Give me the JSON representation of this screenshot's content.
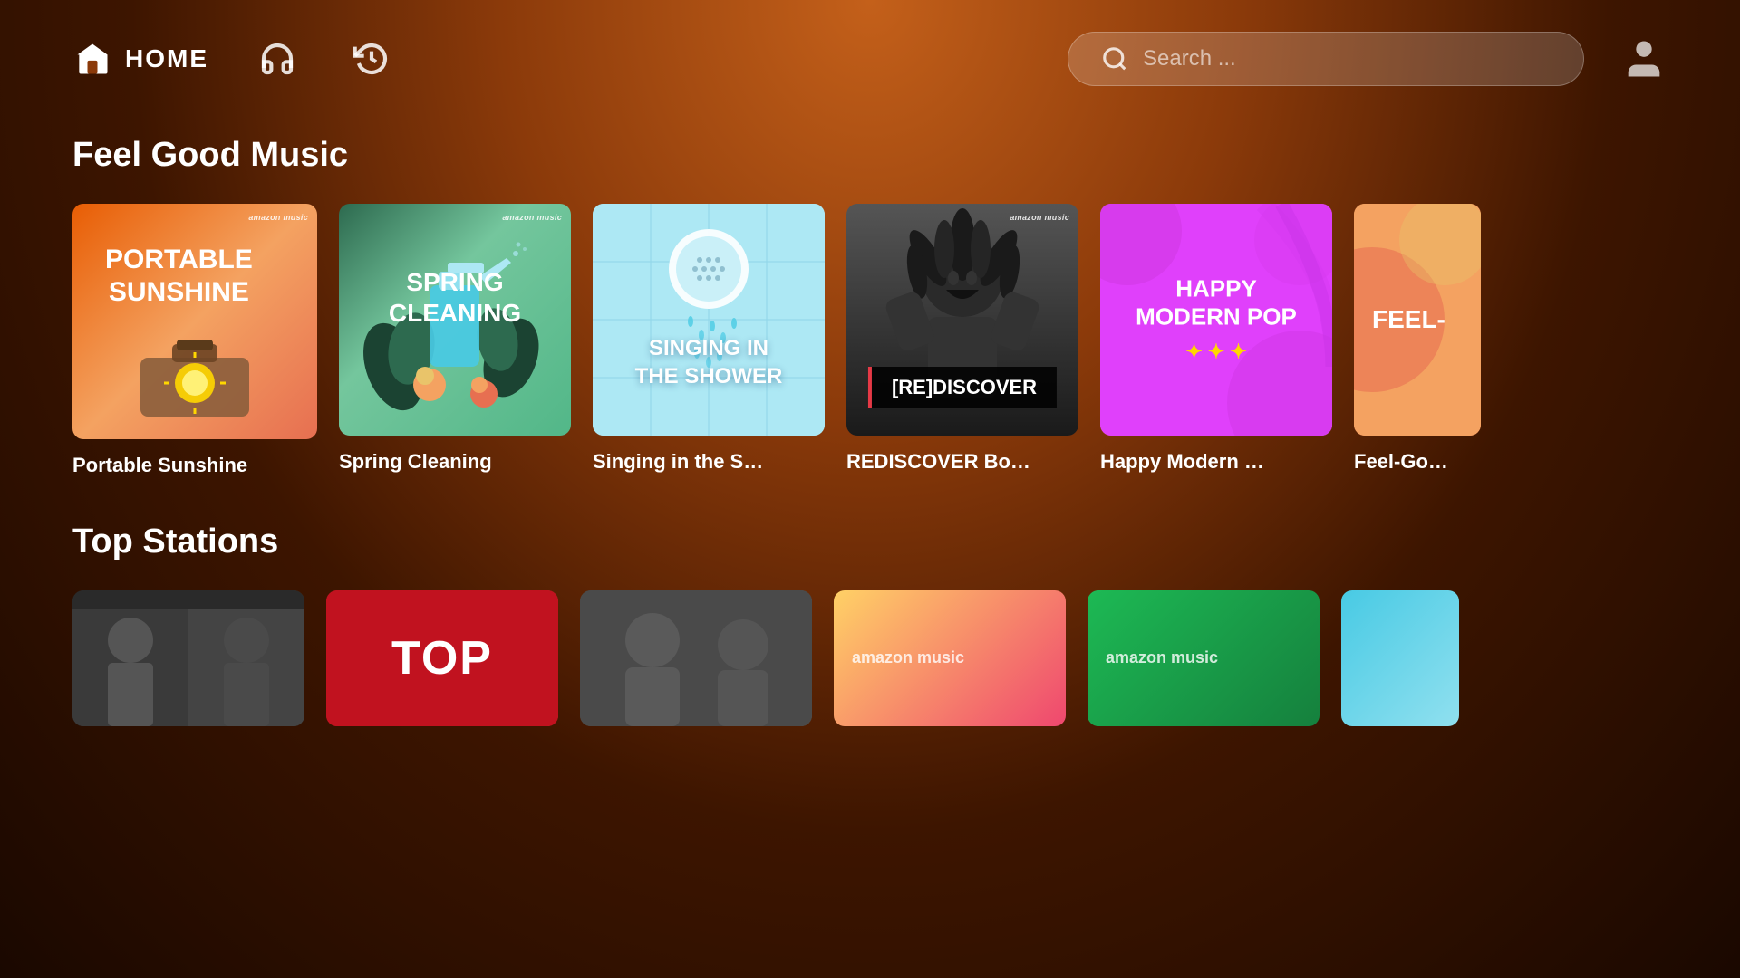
{
  "header": {
    "home_label": "HOME",
    "search_placeholder": "Search ...",
    "nav": {
      "home": "home",
      "headphones": "headphones",
      "history": "history",
      "profile": "profile"
    }
  },
  "sections": {
    "feel_good": {
      "title": "Feel Good Music",
      "cards": [
        {
          "id": "portable-sunshine",
          "label": "Portable Sunshine",
          "title_line1": "PORTABLE",
          "title_line2": "SUNSHINE"
        },
        {
          "id": "spring-cleaning",
          "label": "Spring Cleaning",
          "title_line1": "SPRING",
          "title_line2": "CLEANING"
        },
        {
          "id": "singing-shower",
          "label": "Singing in the S…",
          "title_line1": "SINGING IN",
          "title_line2": "THE SHOWER"
        },
        {
          "id": "rediscover",
          "label": "REDISCOVER Bo…",
          "badge": "[RE]DISCOVER"
        },
        {
          "id": "happy-modern",
          "label": "Happy Modern …",
          "title_line1": "HAPPY",
          "title_line2": "MODERN POP"
        },
        {
          "id": "feel-good-partial",
          "label": "Feel-Go…",
          "partial_text": "FEEL-"
        }
      ]
    },
    "top_stations": {
      "title": "Top Stations",
      "cards": [
        {
          "id": "station-1",
          "type": "dark"
        },
        {
          "id": "station-2",
          "type": "red",
          "text": "ToP"
        },
        {
          "id": "station-3",
          "type": "muted"
        },
        {
          "id": "station-4",
          "type": "yellow-pink"
        },
        {
          "id": "station-5",
          "type": "amz-green"
        },
        {
          "id": "station-6",
          "type": "teal"
        }
      ]
    }
  }
}
